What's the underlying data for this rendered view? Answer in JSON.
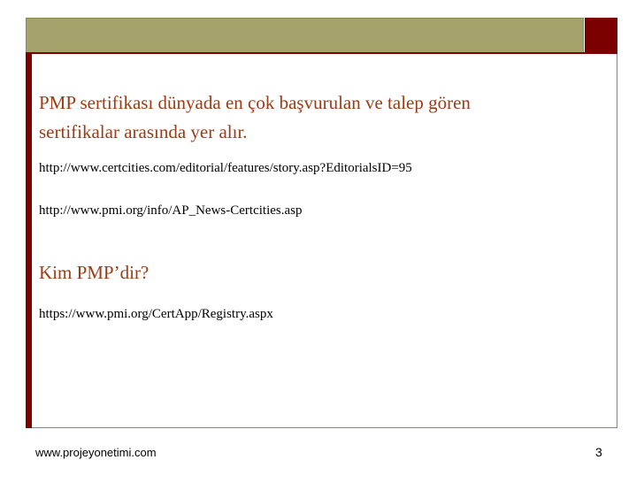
{
  "slide": {
    "heading_line1": "PMP sertifikası dünyada en çok başvurulan ve talep gören",
    "heading_line2": "sertifikalar arasında yer alır.",
    "link1": "http://www.certcities.com/editorial/features/story.asp?EditorialsID=95",
    "link2": "http://www.pmi.org/info/AP_News-Certcities.asp",
    "subheading": "Kim PMP’dir?",
    "link3": "https://www.pmi.org/CertApp/Registry.aspx"
  },
  "footer": {
    "website": "www.projeyonetimi.com",
    "page_number": "3"
  },
  "colors": {
    "header_olive": "#a6a26b",
    "accent_maroon": "#7b0000",
    "heading_text": "#9c3b14"
  }
}
